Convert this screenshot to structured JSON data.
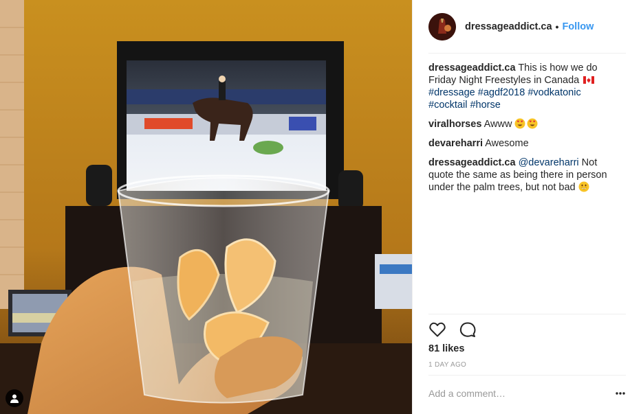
{
  "post": {
    "author": "dressageaddict.ca",
    "follow_label": "Follow",
    "separator": "•",
    "likes": "81 likes",
    "timestamp": "1 DAY AGO",
    "add_comment_placeholder": "Add a comment…",
    "caption": {
      "username": "dressageaddict.ca",
      "text": "This is how we do Friday Night Freestyles in Canada",
      "flag_icon": "canada-flag-icon",
      "hashtags": [
        "#dressage",
        "#agdf2018",
        "#vodkatonic",
        "#cocktail",
        "#horse"
      ]
    },
    "comments": [
      {
        "username": "viralhorses",
        "text": "Awww",
        "emoji": "heart-eyes-emoji-icon"
      },
      {
        "username": "devareharri",
        "text": "Awesome"
      },
      {
        "username": "dressageaddict.ca",
        "mention": "@devareharri",
        "text": "Not quote the same as being there in person under the palm trees, but not bad",
        "emoji": "smile-emoji-icon"
      }
    ]
  },
  "icons": {
    "like": "heart-icon",
    "comment": "comment-icon",
    "more": "more-options-icon",
    "tagged": "tagged-user-icon"
  },
  "colors": {
    "accent": "#3897f0",
    "hashtag": "#003569",
    "text": "#262626",
    "muted": "#999999",
    "divider": "#efefef"
  }
}
